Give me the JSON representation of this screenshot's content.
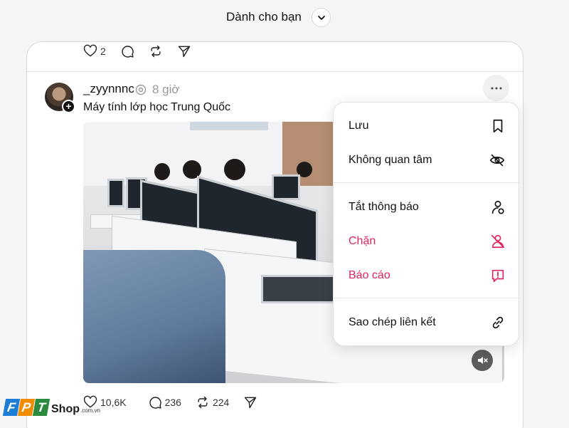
{
  "header": {
    "feed_title": "Dành cho bạn"
  },
  "previous_post": {
    "likes": "2"
  },
  "post": {
    "username": "_zyynnnc",
    "time": "8 giờ",
    "caption": "Máy tính lớp học Trung Quốc",
    "likes": "10,6K",
    "comments": "236",
    "reposts": "224"
  },
  "menu": {
    "items": [
      {
        "label": "Lưu",
        "icon": "bookmark-icon"
      },
      {
        "label": "Không quan tâm",
        "icon": "eye-off-icon"
      },
      {
        "label": "Tắt thông báo",
        "icon": "mute-user-icon"
      },
      {
        "label": "Chặn",
        "icon": "block-user-icon"
      },
      {
        "label": "Báo cáo",
        "icon": "report-icon"
      },
      {
        "label": "Sao chép liên kết",
        "icon": "link-icon"
      }
    ]
  },
  "brand": {
    "name_letters": [
      "F",
      "P",
      "T"
    ],
    "shop": "Shop",
    "domain": ".com.vn"
  },
  "colors": {
    "danger": "#e0245e",
    "fpt_f": "#1c7ed6",
    "fpt_p": "#f08c00",
    "fpt_t": "#2b8a3e"
  }
}
